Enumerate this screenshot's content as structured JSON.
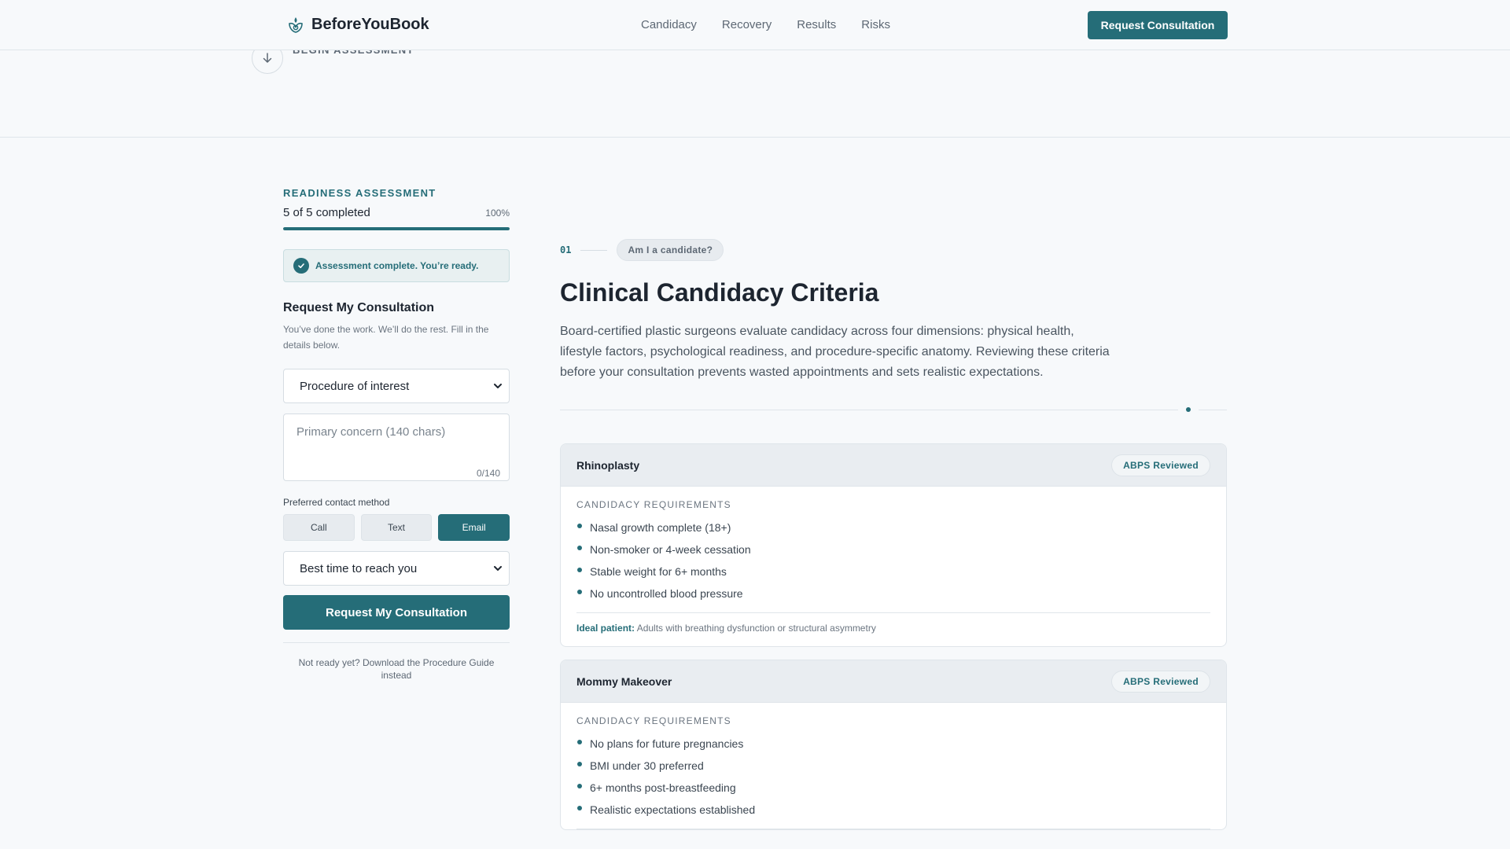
{
  "header": {
    "brand": "BeforeYouBook",
    "nav": [
      "Candidacy",
      "Recovery",
      "Results",
      "Risks"
    ],
    "cta_label": "Request Consultation"
  },
  "hero": {
    "begin_label": "BEGIN ASSESSMENT"
  },
  "sidebar": {
    "eyebrow": "READINESS ASSESSMENT",
    "progress_text": "5 of 5 completed",
    "progress_pct": "100%",
    "progress_fraction": 1.0,
    "complete_message": "Assessment complete. You’re ready.",
    "form_title": "Request My Consultation",
    "form_desc": "You’ve done the work. We’ll do the rest. Fill in the details below.",
    "procedure_select": "Procedure of interest",
    "concern_placeholder": "Primary concern (140 chars)",
    "concern_count": "0/140",
    "contact_label": "Preferred contact method",
    "contact_options": [
      "Call",
      "Text",
      "Email"
    ],
    "contact_selected": "Email",
    "time_select": "Best time to reach you",
    "submit_label": "Request My Consultation",
    "not_ready": "Not ready yet? Download the Procedure Guide instead"
  },
  "main": {
    "step_number": "01",
    "step_pill": "Am I a candidate?",
    "title": "Clinical Candidacy Criteria",
    "description": "Board-certified plastic surgeons evaluate candidacy across four dimensions: physical health, lifestyle factors, psychological readiness, and procedure-specific anatomy. Reviewing these criteria before your consultation prevents wasted appointments and sets realistic expectations.",
    "cards": [
      {
        "title": "Rhinoplasty",
        "badge": "ABPS Reviewed",
        "req_label": "CANDIDACY REQUIREMENTS",
        "requirements": [
          "Nasal growth complete (18+)",
          "Non-smoker or 4-week cessation",
          "Stable weight for 6+ months",
          "No uncontrolled blood pressure"
        ],
        "ideal_label": "Ideal patient:",
        "ideal_text": "Adults with breathing dysfunction or structural asymmetry"
      },
      {
        "title": "Mommy Makeover",
        "badge": "ABPS Reviewed",
        "req_label": "CANDIDACY REQUIREMENTS",
        "requirements": [
          "No plans for future pregnancies",
          "BMI under 30 preferred",
          "6+ months post-breastfeeding",
          "Realistic expectations established"
        ]
      }
    ]
  },
  "colors": {
    "accent": "#256d78",
    "background": "#f7f9fb",
    "card_header": "#e9edf1"
  }
}
